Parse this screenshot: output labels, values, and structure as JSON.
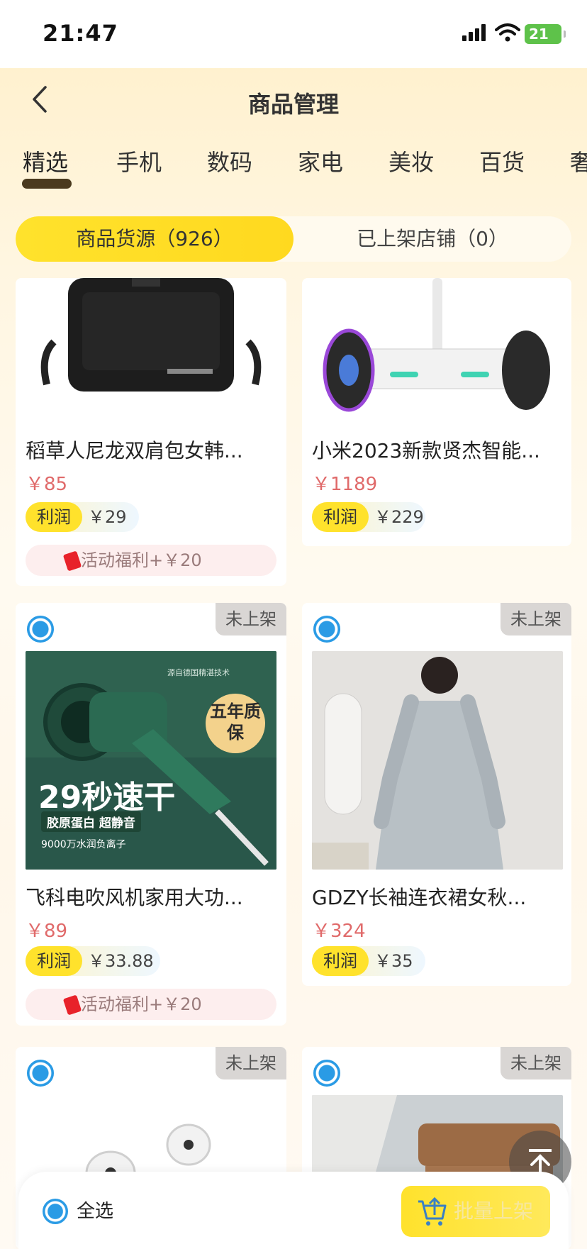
{
  "status_bar": {
    "time": "21:47",
    "battery": "21"
  },
  "header": {
    "title": "商品管理"
  },
  "category_tabs": [
    "精选",
    "手机",
    "数码",
    "家电",
    "美妆",
    "百货",
    "奢"
  ],
  "segment": {
    "left": "商品货源（926）",
    "right": "已上架店铺（0）"
  },
  "products": [
    {
      "name": "稻草人尼龙双肩包女韩...",
      "price": "￥85",
      "profit_label": "利润",
      "profit": "￥29",
      "welfare": "活动福利+￥20"
    },
    {
      "name": "小米2023新款贤杰智能...",
      "price": "￥1189",
      "profit_label": "利润",
      "profit": "￥229"
    },
    {
      "name": "飞科电吹风机家用大功...",
      "price": "￥89",
      "profit_label": "利润",
      "profit": "￥33.88",
      "welfare": "活动福利+￥20",
      "badge": "未上架",
      "image_text": {
        "tag": "五年质保",
        "headline": "29秒速干",
        "sub": "胶原蛋白  超静音",
        "sub2": "9000万水润负离子",
        "top": "源自德国精湛技术"
      }
    },
    {
      "name": "GDZY长袖连衣裙女秋...",
      "price": "￥324",
      "profit_label": "利润",
      "profit": "￥35",
      "badge": "未上架"
    },
    {
      "badge": "未上架"
    },
    {
      "badge": "未上架"
    }
  ],
  "bottom_bar": {
    "select_all": "全选",
    "batch_button": "批量上架"
  },
  "colors": {
    "accent_yellow": "#ffe22c",
    "price_red": "#e06a6a",
    "radio_blue": "#2a9be5"
  }
}
